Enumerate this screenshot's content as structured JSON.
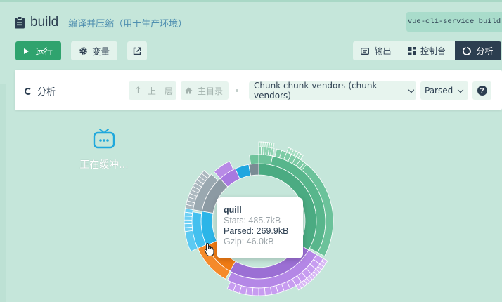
{
  "header": {
    "title": "build",
    "description": "编译并压缩（用于生产环境）",
    "command": "vue-cli-service build"
  },
  "toolbar": {
    "run_label": "运行",
    "vars_label": "变量",
    "external_icon": "external-link-icon"
  },
  "view_tabs": [
    {
      "label": "输出",
      "icon": "output-icon",
      "active": false
    },
    {
      "label": "控制台",
      "icon": "dashboard-icon",
      "active": false
    },
    {
      "label": "分析",
      "icon": "analysis-icon",
      "active": true
    }
  ],
  "analysis": {
    "title": "分析",
    "up_label": "上一层",
    "root_label": "主目录",
    "chunk_select": "Chunk chunk-vendors (chunk-vendors)",
    "size_select": "Parsed",
    "help_icon": "help-icon"
  },
  "buffering": {
    "text": "正在缓冲..."
  },
  "tooltip": {
    "name": "quill",
    "stats": "Stats: 485.7kB",
    "parsed": "Parsed: 269.9kB",
    "gzip": "Gzip: 46.0kB"
  },
  "colors": {
    "primary": "#2fa36e",
    "dark": "#2c3e50",
    "accent": "#4f8fb0",
    "background": "#c5e6da"
  }
}
